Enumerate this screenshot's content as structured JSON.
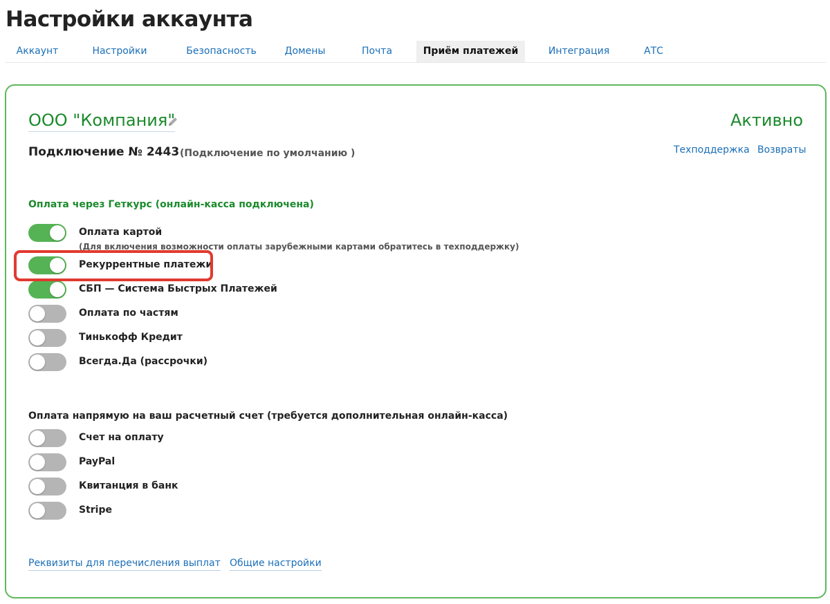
{
  "page": {
    "title": "Настройки аккаунта"
  },
  "tabs": [
    {
      "label": "Аккаунт"
    },
    {
      "label": "Настройки"
    },
    {
      "label": "Безопасность"
    },
    {
      "label": "Домены"
    },
    {
      "label": "Почта"
    },
    {
      "label": "Приём платежей",
      "active": true
    },
    {
      "label": "Интеграция"
    },
    {
      "label": "АТС"
    }
  ],
  "card": {
    "company_name": "ООО \"Компания\"",
    "edit_icon": "pencil-icon",
    "status": "Активно",
    "connection_title": "Подключение № 2443",
    "connection_subtitle": "(Подключение по умолчанию )",
    "links": {
      "support": "Техподдержка",
      "refunds": "Возвраты"
    }
  },
  "getcourse_section": {
    "title": "Оплата через Геткурс (онлайн-касса подключена)",
    "options": [
      {
        "label": "Оплата картой",
        "enabled": true,
        "note": "(Для включения возможности оплаты зарубежными картами обратитесь в техподдержку)"
      },
      {
        "label": "Рекуррентные платежи",
        "enabled": true,
        "highlighted": true
      },
      {
        "label": "СБП — Система Быстрых Платежей",
        "enabled": true
      },
      {
        "label": "Оплата по частям",
        "enabled": false
      },
      {
        "label": "Тинькофф Кредит",
        "enabled": false
      },
      {
        "label": "Всегда.Да (рассрочки)",
        "enabled": false
      }
    ]
  },
  "direct_section": {
    "title": "Оплата напрямую на ваш расчетный счет (требуется дополнительная онлайн-касса)",
    "options": [
      {
        "label": "Счет на оплату",
        "enabled": false
      },
      {
        "label": "PayPal",
        "enabled": false
      },
      {
        "label": "Квитанция в банк",
        "enabled": false
      },
      {
        "label": "Stripe",
        "enabled": false
      }
    ]
  },
  "footer_links": {
    "payout_details": "Реквизиты для перечисления выплат",
    "general_settings": "Общие настройки"
  },
  "colors": {
    "accent_green": "#1b8a2c",
    "toggle_on": "#55b355",
    "toggle_off": "#b5b5b5",
    "link_blue": "#1a6fb8",
    "highlight_red": "#e03a2f"
  }
}
